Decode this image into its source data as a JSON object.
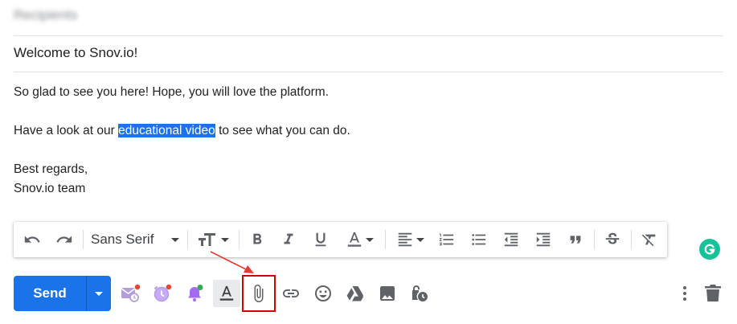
{
  "recipients": {
    "placeholder": "Recipients"
  },
  "subject": "Welcome to Snov.io!",
  "body": {
    "line1": "So glad to see you here! Hope, you will love the platform.",
    "line2_before": "Have a look at our ",
    "line2_link": "educational video",
    "line2_after": " to see what you can do.",
    "line3": "Best regards,",
    "line4": "Snov.io team"
  },
  "format_toolbar": {
    "font_family": "Sans Serif",
    "icons": [
      "undo-icon",
      "redo-icon",
      "font-family-select",
      "font-size-icon",
      "bold-icon",
      "italic-icon",
      "underline-icon",
      "text-color-icon",
      "align-icon",
      "numbered-list-icon",
      "bulleted-list-icon",
      "indent-less-icon",
      "indent-more-icon",
      "quote-icon",
      "strikethrough-icon",
      "remove-formatting-icon"
    ]
  },
  "send": {
    "label": "Send"
  },
  "bottom_toolbar": {
    "icons": [
      "schedule-mail-icon",
      "snooze-clock-icon",
      "notification-bell-icon",
      "formatting-options-icon",
      "attach-file-icon",
      "insert-link-icon",
      "insert-emoji-icon",
      "google-drive-icon",
      "insert-photo-icon",
      "confidential-mode-icon",
      "more-options-icon",
      "discard-draft-icon"
    ]
  },
  "colors": {
    "accent": "#1a73e8",
    "annotation": "#d50000",
    "grammarly": "#15c39a",
    "badge": "#ea4335"
  }
}
